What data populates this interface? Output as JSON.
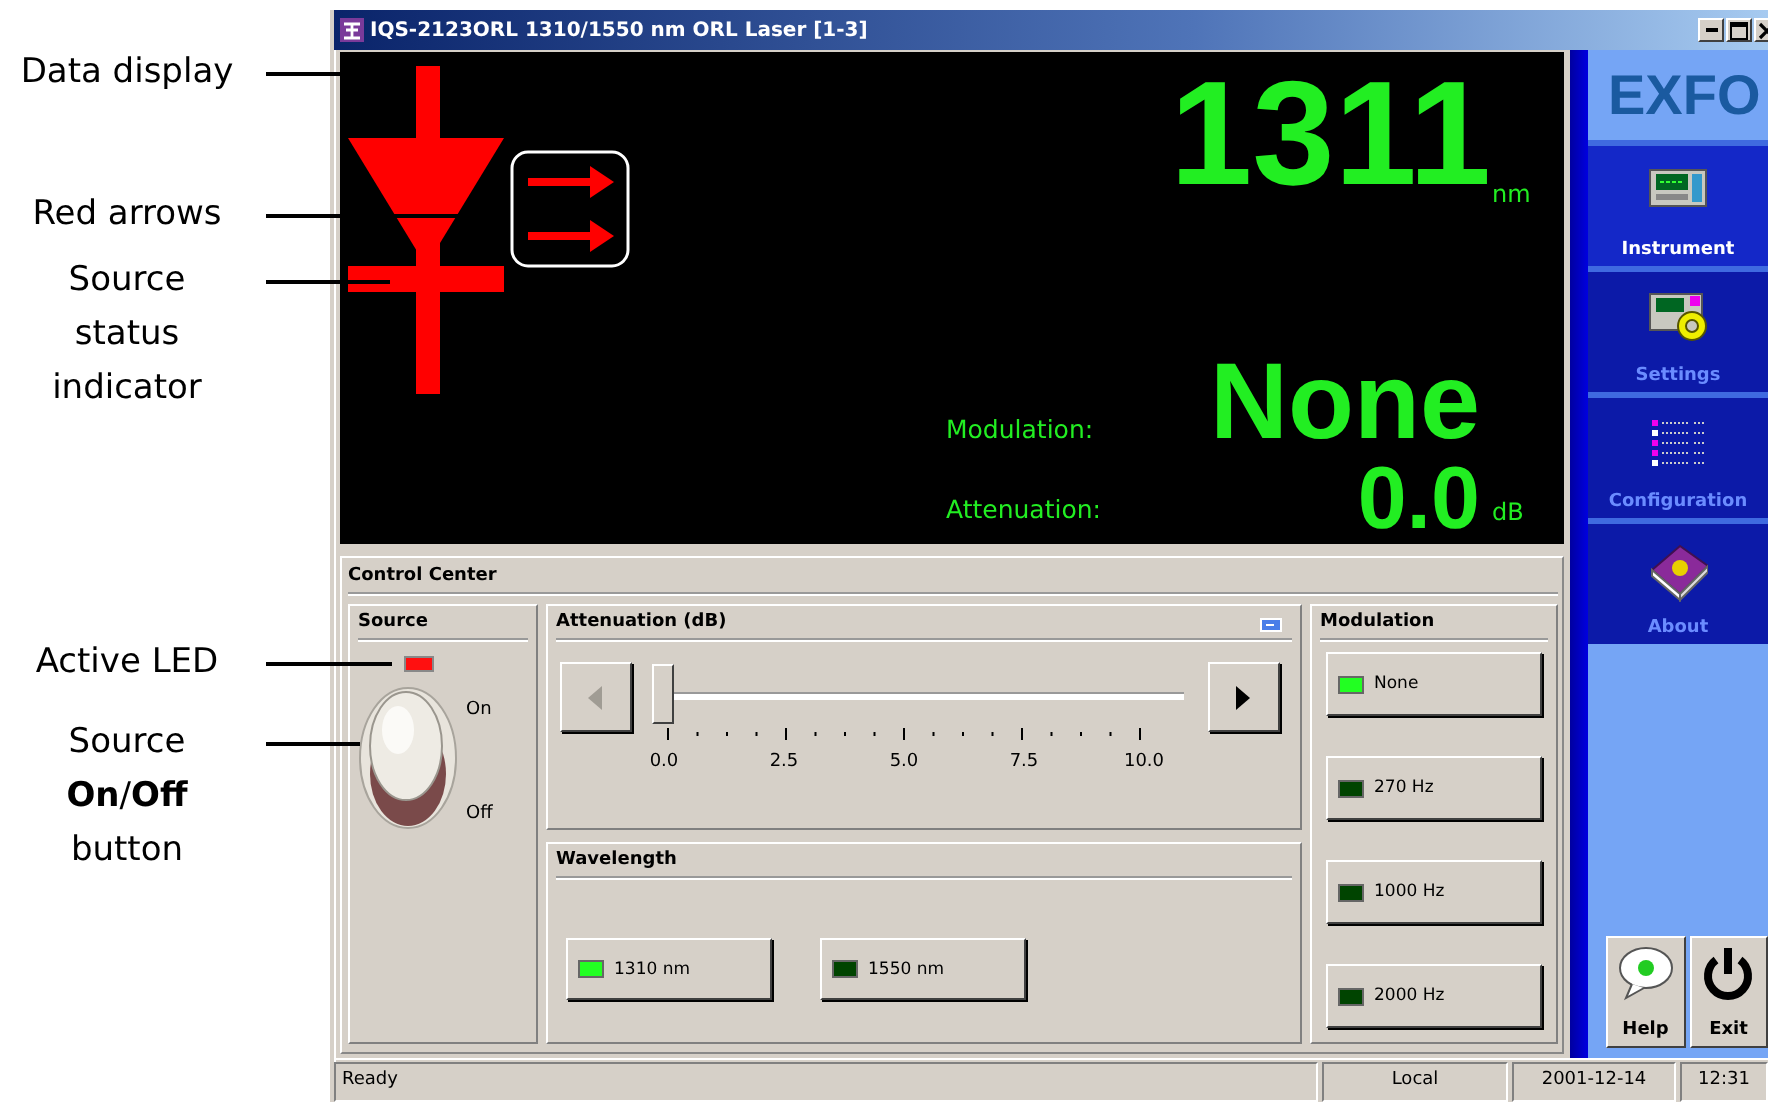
{
  "callouts": [
    {
      "lines": [
        "Data display"
      ]
    },
    {
      "lines": [
        "Red arrows"
      ]
    },
    {
      "lines": [
        "Source",
        "status",
        "indicator"
      ]
    },
    {
      "lines": [
        "Active LED"
      ]
    },
    {
      "lines": [
        "Source",
        "**On**/**Off**",
        "button"
      ]
    }
  ],
  "window": {
    "title": "IQS-2123ORL 1310/1550 nm ORL Laser [1-3]"
  },
  "display": {
    "wavelength": "1311",
    "wavelength_unit": "nm",
    "modulation_label": "Modulation:",
    "modulation": "None",
    "attenuation_label": "Attenuation:",
    "attenuation": "0.0",
    "attenuation_unit": "dB"
  },
  "control_center": {
    "title": "Control Center",
    "source": {
      "title": "Source",
      "led_on": true,
      "switch_on": true,
      "on_label": "On",
      "off_label": "Off"
    },
    "attenuation": {
      "title": "Attenuation (dB)",
      "level": 0,
      "ticks": [
        "0.0",
        "2.5",
        "5.0",
        "7.5",
        "10.0"
      ]
    },
    "wavelength": {
      "title": "Wavelength",
      "options": [
        {
          "label": "1310 nm",
          "selected": true
        },
        {
          "label": "1550 nm",
          "selected": false
        }
      ]
    },
    "modulation": {
      "title": "Modulation",
      "options": [
        {
          "label": "None",
          "selected": true
        },
        {
          "label": "270 Hz",
          "selected": false
        },
        {
          "label": "1000 Hz",
          "selected": false
        },
        {
          "label": "2000 Hz",
          "selected": false
        }
      ]
    }
  },
  "sidebar": {
    "logo": "EXFO",
    "items": [
      {
        "label": "Instrument",
        "kind": "instrument",
        "selected": true
      },
      {
        "label": "Settings",
        "kind": "settings",
        "selected": false
      },
      {
        "label": "Configuration",
        "kind": "configuration",
        "selected": false
      },
      {
        "label": "About",
        "kind": "about",
        "selected": false
      }
    ],
    "buttons": [
      {
        "label": "Help",
        "kind": "help"
      },
      {
        "label": "Exit",
        "kind": "exit"
      }
    ]
  },
  "status_bar": [
    "Ready",
    "Local",
    "2001-12-14",
    "12:31"
  ]
}
